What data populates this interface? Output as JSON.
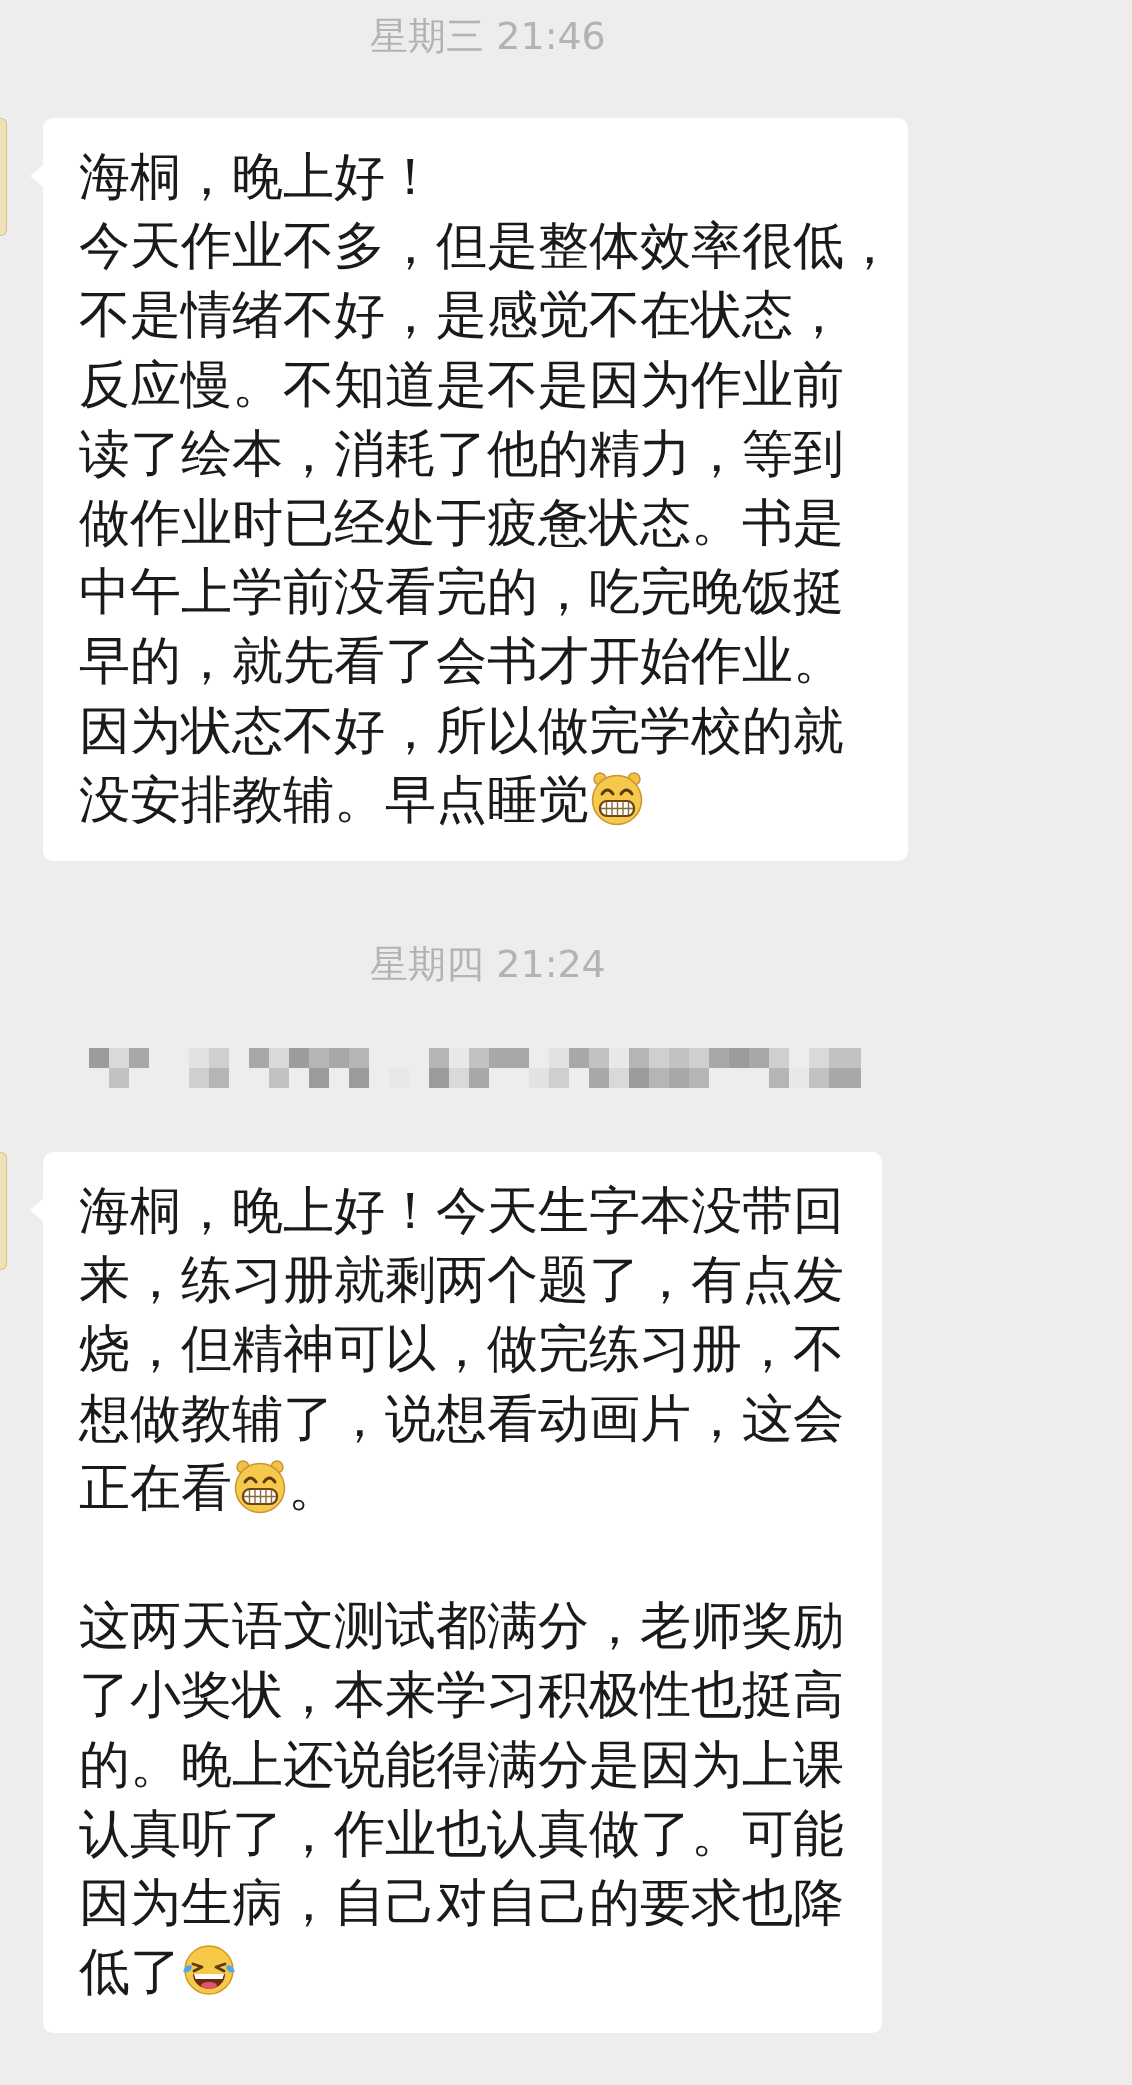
{
  "chat": [
    {
      "kind": "timestamp",
      "text": "星期三 21:46"
    },
    {
      "kind": "message",
      "paragraphs": [
        [
          {
            "kind": "text",
            "text": "海桐，晚上好！"
          },
          {
            "kind": "text",
            "text": "今天作业不多，但是整体效率很低，不是情绪不好，是感觉不在状态，反应慢。不知道是不是因为作业前读了绘本，消耗了他的精力，等到做作业时已经处于疲惫状态。书是中午上学前没看完的，吃完晚饭挺早的，就先看了会书才开始作业。因为状态不好，所以做完学校的就"
          },
          {
            "kind": "text",
            "text": "没安排教辅。早点睡觉"
          },
          {
            "kind": "grin"
          }
        ]
      ]
    },
    {
      "kind": "timestamp",
      "text": "星期四 21:24"
    },
    {
      "kind": "redacted"
    },
    {
      "kind": "message",
      "paragraphs": [
        [
          {
            "kind": "text",
            "text": "海桐，晚上好！今天生字本没带回来，练习册就剩两个题了，有点发烧，但精神可以，做完练习册，不想做教辅了，说想看动画片，这会"
          },
          {
            "kind": "text",
            "text": "正在看"
          },
          {
            "kind": "grin"
          },
          {
            "kind": "text",
            "text": "。"
          }
        ],
        [
          {
            "kind": "text",
            "text": "这两天语文测试都满分，老师奖励了小奖状，本来学习积极性也挺高的。晚上还说能得满分是因为上课认真听了，作业也认真做了。可能因为生病，自己对自己的要求也降"
          },
          {
            "kind": "text",
            "text": "低了"
          },
          {
            "kind": "laugh_tears"
          }
        ]
      ]
    }
  ]
}
